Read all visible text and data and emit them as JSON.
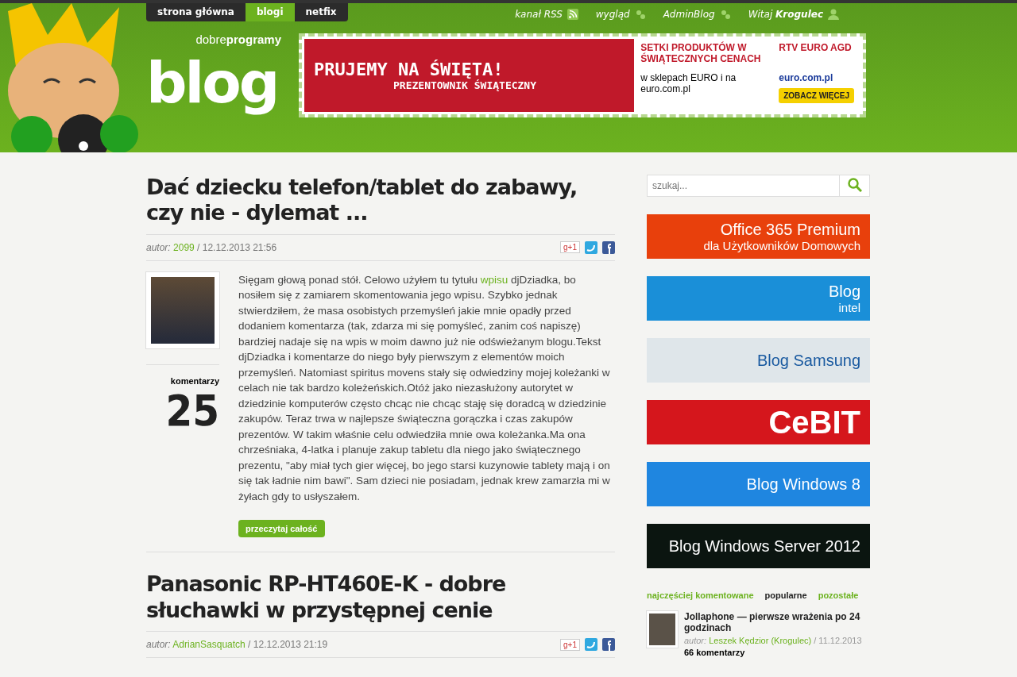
{
  "nav": {
    "tabs": [
      {
        "label": "strona główna",
        "selected": false
      },
      {
        "label": "blogi",
        "selected": true
      },
      {
        "label": "netfix",
        "selected": false
      }
    ],
    "links": [
      {
        "label": "kanał RSS",
        "kind": "rss"
      },
      {
        "label": "wygląd",
        "kind": "gears"
      },
      {
        "label": "AdminBlog",
        "kind": "gears"
      },
      {
        "label": "Witaj **Krogulec**",
        "kind": "user"
      }
    ]
  },
  "logo": {
    "word": "blog",
    "brand": "dobre**programy**"
  },
  "banner": {
    "headline": "PRUJEMY NA ŚWIĘTA!",
    "subline": "PREZENTOWNIK ŚWIĄTECZNY",
    "offer": "SETKI PRODUKTÓW W ŚWIĄTECZNYCH CENACH",
    "where": "w sklepach EURO i na euro.com.pl",
    "brand": "RTV EURO AGD",
    "domain": "euro.com.pl",
    "cta": "ZOBACZ WIĘCEJ"
  },
  "posts": [
    {
      "title": "Dać dziecku telefon/tablet do zabawy, czy nie - dylemat ...",
      "author_label": "autor:",
      "author": "2099",
      "date": "/ 12.12.2013 21:56",
      "comments_label": "komentarzy",
      "comments": "25",
      "body_before": "Sięgam głową ponad stół. Celowo użyłem tu tytułu ",
      "body_link": "wpisu",
      "body_after": " djDziadka, bo nosiłem się z zamiarem skomentowania jego wpisu. Szybko jednak stwierdziłem, że masa osobistych przemyśleń jakie mnie opadły przed dodaniem komentarza (tak, zdarza mi się pomyśleć, zanim coś napiszę) bardziej nadaje się na wpis w moim dawno już nie odświeżanym blogu.Tekst djDziadka i komentarze do niego były pierwszym z elementów moich przemyśleń. Natomiast spiritus movens stały się odwiedziny mojej koleżanki w celach nie tak bardzo koleżeńskich.Otóż jako niezasłużony autorytet w dziedzinie komputerów często chcąc nie chcąc staję się doradcą w dziedzinie zakupów. Teraz trwa w najlepsze świąteczna gorączka i czas zakupów prezentów. W takim właśnie celu odwiedziła mnie owa koleżanka.Ma ona chrześniaka, 4-latka i planuje zakup tabletu dla niego jako świątecznego prezentu, \"aby miał tych gier więcej, bo jego starsi kuzynowie tablety mają i on się tak ładnie nim bawi\". Sam dzieci nie posiadam, jednak krew zamarzła mi w żyłach gdy to usłyszałem.",
      "more": "przeczytaj całość",
      "share": "g+1"
    },
    {
      "title": "Panasonic RP-HT460E-K - dobre słuchawki w przystępnej cenie",
      "author_label": "autor:",
      "author": "AdrianSasquatch",
      "date": "/ 12.12.2013 21:19",
      "share": "g+1"
    }
  ],
  "search": {
    "placeholder": "szukaj..."
  },
  "promos": [
    {
      "kind": "office",
      "line1": "Office 365 Premium",
      "line2": "dla Użytkowników Domowych"
    },
    {
      "kind": "intel",
      "line1": "Blog",
      "line2": "intel"
    },
    {
      "kind": "samsung",
      "line1": "Blog Samsung"
    },
    {
      "kind": "cebit",
      "line1": "CeBIT"
    },
    {
      "kind": "windows8",
      "line1": "Blog Windows 8"
    },
    {
      "kind": "server",
      "line1": "Blog Windows Server 2012"
    }
  ],
  "tabs": [
    {
      "label": "najczęściej komentowane",
      "selected": false
    },
    {
      "label": "popularne",
      "selected": true
    },
    {
      "label": "pozostałe",
      "selected": false
    }
  ],
  "top_posts": [
    {
      "title": "Jollaphone — pierwsze wrażenia po 24 godzinach",
      "author_label": "autor:",
      "author": "Leszek Kędzior (Krogulec)",
      "date": "/ 11.12.2013",
      "comments": "66 komentarzy"
    }
  ]
}
